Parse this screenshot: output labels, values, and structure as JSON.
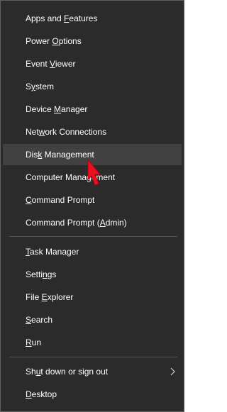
{
  "menu": {
    "groups": [
      {
        "items": [
          {
            "pre": "Apps and ",
            "key": "F",
            "post": "eatures"
          },
          {
            "pre": "Power ",
            "key": "O",
            "post": "ptions"
          },
          {
            "pre": "Event ",
            "key": "V",
            "post": "iewer"
          },
          {
            "pre": "S",
            "key": "y",
            "post": "stem"
          },
          {
            "pre": "Device ",
            "key": "M",
            "post": "anager"
          },
          {
            "pre": "Net",
            "key": "w",
            "post": "ork Connections"
          },
          {
            "pre": "Dis",
            "key": "k",
            "post": " Management"
          },
          {
            "pre": "Computer Mana",
            "key": "g",
            "post": "ement"
          },
          {
            "pre": "",
            "key": "C",
            "post": "ommand Prompt"
          },
          {
            "pre": "Command Prompt (",
            "key": "A",
            "post": "dmin)"
          }
        ]
      },
      {
        "items": [
          {
            "pre": "",
            "key": "T",
            "post": "ask Manager"
          },
          {
            "pre": "Setti",
            "key": "n",
            "post": "gs"
          },
          {
            "pre": "File ",
            "key": "E",
            "post": "xplorer"
          },
          {
            "pre": "",
            "key": "S",
            "post": "earch"
          },
          {
            "pre": "",
            "key": "R",
            "post": "un"
          }
        ]
      },
      {
        "items": [
          {
            "pre": "Sh",
            "key": "u",
            "post": "t down or sign out"
          },
          {
            "pre": "",
            "key": "D",
            "post": "esktop"
          }
        ]
      }
    ],
    "selected_label": "Disk Management",
    "submenu_item_label": "Shut down or sign out"
  },
  "colors": {
    "background": "#2b2b2b",
    "border": "#5f5f5f",
    "text": "#ffffff",
    "hover": "#414141",
    "separator": "#555555",
    "cursor": "#e81123"
  },
  "icons": {
    "submenu": "chevron-right-icon",
    "pointer": "mouse-cursor-icon"
  }
}
